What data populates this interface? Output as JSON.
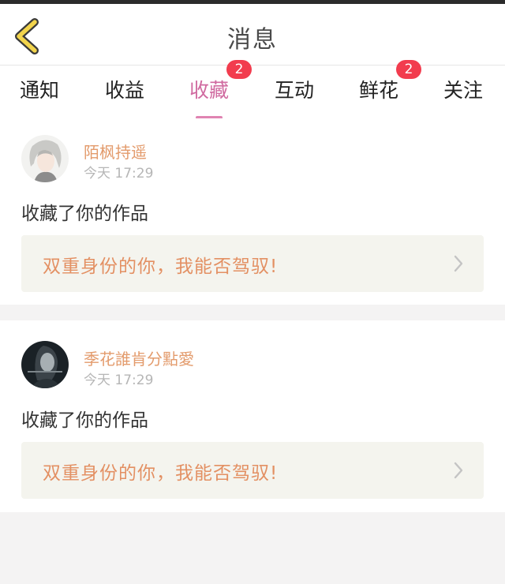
{
  "header": {
    "title": "消息",
    "back_icon": "chevron-left-icon"
  },
  "tabs": [
    {
      "label": "通知",
      "badge": null,
      "active": false
    },
    {
      "label": "收益",
      "badge": null,
      "active": false
    },
    {
      "label": "收藏",
      "badge": "2",
      "active": true
    },
    {
      "label": "互动",
      "badge": null,
      "active": false
    },
    {
      "label": "鲜花",
      "badge": "2",
      "active": false
    },
    {
      "label": "关注",
      "badge": null,
      "active": false
    }
  ],
  "notifications": [
    {
      "username": "陌枫持遥",
      "time": "今天 17:29",
      "action": "收藏了你的作品",
      "work_title": "双重身份的你，我能否驾驭!"
    },
    {
      "username": "季花誰肯分點愛",
      "time": "今天 17:29",
      "action": "收藏了你的作品",
      "work_title": "双重身份的你，我能否驾驭!"
    }
  ],
  "colors": {
    "accent": "#d06aa0",
    "username": "#e39b6c",
    "badge": "#f23c4e",
    "back_icon": "#f2d44c"
  }
}
